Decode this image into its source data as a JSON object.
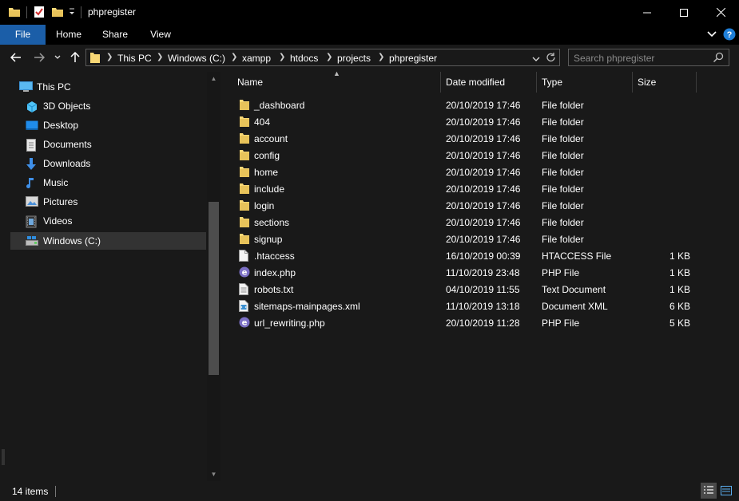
{
  "window": {
    "title": "phpregister"
  },
  "ribbon": {
    "tabs": [
      {
        "label": "File"
      },
      {
        "label": "Home"
      },
      {
        "label": "Share"
      },
      {
        "label": "View"
      }
    ]
  },
  "address": {
    "crumbs": [
      "This PC",
      "Windows (C:)",
      "xampp",
      "htdocs",
      "projects",
      "phpregister"
    ]
  },
  "search": {
    "placeholder": "Search phpregister"
  },
  "nav": {
    "items": [
      {
        "label": "This PC",
        "icon": "this-pc-icon"
      },
      {
        "label": "3D Objects",
        "icon": "3d-objects-icon"
      },
      {
        "label": "Desktop",
        "icon": "desktop-icon"
      },
      {
        "label": "Documents",
        "icon": "documents-icon"
      },
      {
        "label": "Downloads",
        "icon": "downloads-icon"
      },
      {
        "label": "Music",
        "icon": "music-icon"
      },
      {
        "label": "Pictures",
        "icon": "pictures-icon"
      },
      {
        "label": "Videos",
        "icon": "videos-icon"
      },
      {
        "label": "Windows (C:)",
        "icon": "drive-icon"
      }
    ]
  },
  "columns": {
    "name": "Name",
    "date": "Date modified",
    "type": "Type",
    "size": "Size"
  },
  "files": [
    {
      "name": "_dashboard",
      "date": "20/10/2019 17:46",
      "type": "File folder",
      "size": "",
      "icon": "folder-icon"
    },
    {
      "name": "404",
      "date": "20/10/2019 17:46",
      "type": "File folder",
      "size": "",
      "icon": "folder-icon"
    },
    {
      "name": "account",
      "date": "20/10/2019 17:46",
      "type": "File folder",
      "size": "",
      "icon": "folder-icon"
    },
    {
      "name": "config",
      "date": "20/10/2019 17:46",
      "type": "File folder",
      "size": "",
      "icon": "folder-icon"
    },
    {
      "name": "home",
      "date": "20/10/2019 17:46",
      "type": "File folder",
      "size": "",
      "icon": "folder-icon"
    },
    {
      "name": "include",
      "date": "20/10/2019 17:46",
      "type": "File folder",
      "size": "",
      "icon": "folder-icon"
    },
    {
      "name": "login",
      "date": "20/10/2019 17:46",
      "type": "File folder",
      "size": "",
      "icon": "folder-icon"
    },
    {
      "name": "sections",
      "date": "20/10/2019 17:46",
      "type": "File folder",
      "size": "",
      "icon": "folder-icon"
    },
    {
      "name": "signup",
      "date": "20/10/2019 17:46",
      "type": "File folder",
      "size": "",
      "icon": "folder-icon"
    },
    {
      "name": ".htaccess",
      "date": "16/10/2019 00:39",
      "type": "HTACCESS File",
      "size": "1 KB",
      "icon": "blank-file-icon"
    },
    {
      "name": "index.php",
      "date": "11/10/2019 23:48",
      "type": "PHP File",
      "size": "1 KB",
      "icon": "php-file-icon"
    },
    {
      "name": "robots.txt",
      "date": "04/10/2019 11:55",
      "type": "Text Document",
      "size": "1 KB",
      "icon": "text-file-icon"
    },
    {
      "name": "sitemaps-mainpages.xml",
      "date": "11/10/2019 13:18",
      "type": "Document XML",
      "size": "6 KB",
      "icon": "xml-file-icon"
    },
    {
      "name": "url_rewriting.php",
      "date": "20/10/2019 11:28",
      "type": "PHP File",
      "size": "5 KB",
      "icon": "php-file-icon"
    }
  ],
  "status": {
    "count": "14 items"
  },
  "colors": {
    "titlebar": "#000000",
    "background": "#191919",
    "file_tab": "#1b5ea8",
    "selected": "#333333",
    "folder": "#f8d775",
    "php": "#7b6fc4",
    "help": "#1f7fd8"
  }
}
